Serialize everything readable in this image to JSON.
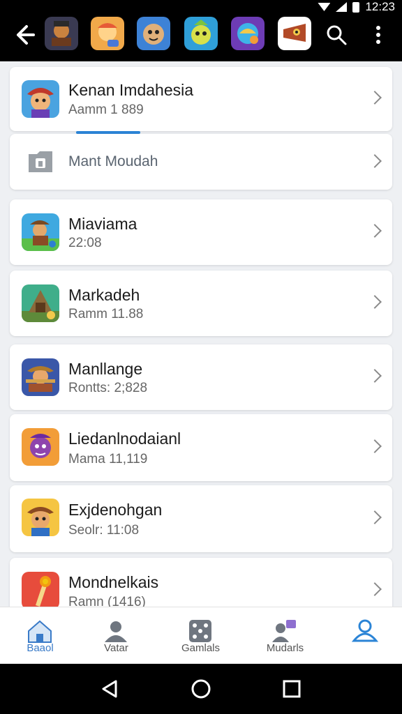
{
  "status": {
    "time": "12:23"
  },
  "header": {
    "top_icons": [
      {
        "name": "game-icon-1",
        "bg": "#3a3a52"
      },
      {
        "name": "game-icon-2",
        "bg": "#f1a94a"
      },
      {
        "name": "game-icon-3",
        "bg": "#3d82d6"
      },
      {
        "name": "game-icon-4",
        "bg": "#2f9fd8"
      },
      {
        "name": "game-icon-5",
        "bg": "#6d3cb5"
      },
      {
        "name": "game-icon-6",
        "bg": "#ffffff"
      }
    ]
  },
  "list": {
    "items": [
      {
        "title": "Kenan Imdahesia",
        "subtitle": "Aamm 1 889",
        "icon": "cowboy-game-icon",
        "progress": 0.18
      },
      {
        "title": "Mant Moudah",
        "subtitle": "",
        "icon": "folder-icon"
      },
      {
        "title": "Miaviama",
        "subtitle": "22:08",
        "icon": "pirate-game-icon"
      },
      {
        "title": "Markadeh",
        "subtitle": "Ramm 11.88",
        "icon": "fort-game-icon"
      },
      {
        "title": "Manllange",
        "subtitle": "Rontts: 2;828",
        "icon": "sheriff-game-icon"
      },
      {
        "title": "Liedanlnodaianl",
        "subtitle": "Mama 11,119",
        "icon": "hero-game-icon"
      },
      {
        "title": "Exjdenohgan",
        "subtitle": "Seolr: 11:08",
        "icon": "explorer-game-icon"
      },
      {
        "title": "Mondnelkais",
        "subtitle": "Ramn (1416)",
        "icon": "torch-game-icon"
      }
    ]
  },
  "bottom_nav": {
    "items": [
      {
        "label": "Baaol",
        "icon": "home-icon",
        "active": true
      },
      {
        "label": "Vatar",
        "icon": "person-icon",
        "active": false
      },
      {
        "label": "Gamlals",
        "icon": "dice-icon",
        "active": false
      },
      {
        "label": "Mudarls",
        "icon": "group-icon",
        "active": false
      },
      {
        "label": "",
        "icon": "profile-icon",
        "active": true
      }
    ]
  },
  "colors": {
    "accent": "#2b84d6",
    "top_bar": "#000000",
    "background": "#eef0f3"
  }
}
